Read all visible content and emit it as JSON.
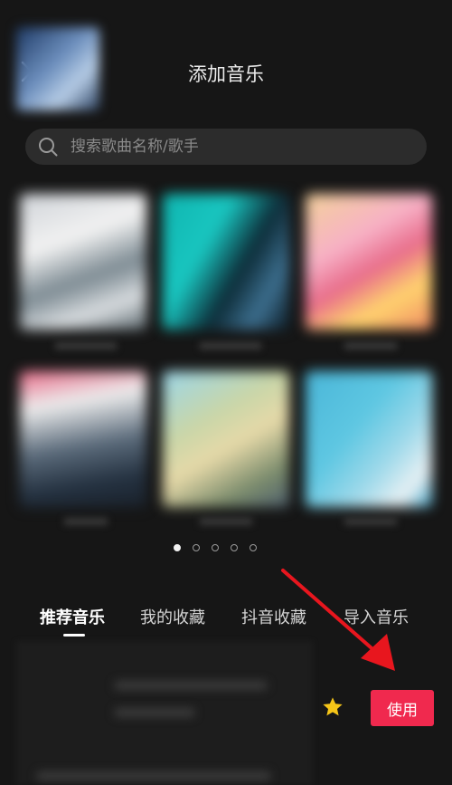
{
  "header": {
    "title": "添加音乐"
  },
  "search": {
    "placeholder": "搜索歌曲名称/歌手"
  },
  "carousel": {
    "page_count": 5,
    "active_page": 1
  },
  "tabs": [
    {
      "label": "推荐音乐",
      "active": true
    },
    {
      "label": "我的收藏",
      "active": false
    },
    {
      "label": "抖音收藏",
      "active": false
    },
    {
      "label": "导入音乐",
      "active": false
    }
  ],
  "song_row": {
    "use_label": "使用"
  },
  "icons": {
    "close": "close-icon",
    "search": "search-icon",
    "favorite": "star-icon"
  },
  "colors": {
    "background": "#161616",
    "accent": "#f0294e",
    "favorite_star": "#f5c518",
    "annotation_arrow": "#e8161e"
  }
}
